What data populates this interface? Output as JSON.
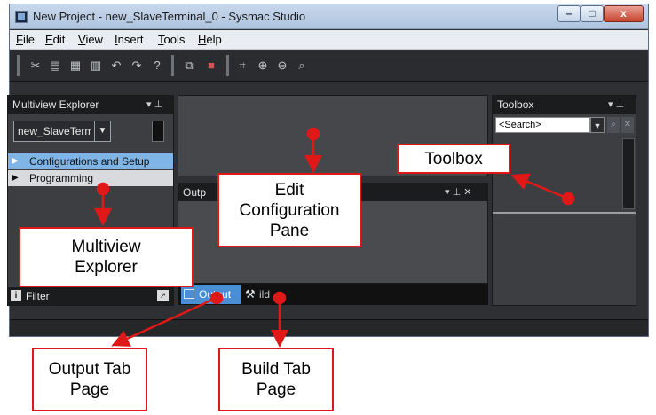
{
  "window": {
    "title": "New Project - new_SlaveTerminal_0 - Sysmac Studio",
    "controls": {
      "minimize": "–",
      "maximize": "□",
      "close": "x"
    }
  },
  "menu": {
    "items": [
      {
        "first": "F",
        "rest": "ile"
      },
      {
        "first": "E",
        "rest": "dit"
      },
      {
        "first": "V",
        "rest": "iew"
      },
      {
        "first": "I",
        "rest": "nsert"
      },
      {
        "first": "T",
        "rest": "ools"
      },
      {
        "first": "H",
        "rest": "elp"
      }
    ]
  },
  "toolbar": {
    "icons": [
      "cut-icon",
      "copy-icon",
      "paste-icon",
      "delete-icon",
      "undo-icon",
      "redo-icon",
      "help-icon",
      "window-icon",
      "error-icon",
      "fit-icon",
      "zoom-in-icon",
      "zoom-out-icon",
      "zoom-100-icon"
    ]
  },
  "multiview": {
    "title": "Multiview Explorer",
    "pin": "▾ ⊥",
    "device_combo": "new_SlaveTerm",
    "tree": [
      {
        "arrow": "▶",
        "label": "Configurations and Setup",
        "selected": true
      },
      {
        "arrow": "▶",
        "label": "Programming",
        "selected": false
      }
    ],
    "filter_icon": "i",
    "filter_label": "Filter",
    "filter_button": "↗"
  },
  "output": {
    "title": "Outp",
    "controls": "▾ ⊥ ✕"
  },
  "tabs": {
    "output": "Output",
    "build": "ild"
  },
  "toolbox": {
    "title": "Toolbox",
    "pin": "▾ ⊥",
    "search_placeholder": "<Search>",
    "search_arrow": "▼",
    "find": "⌕",
    "clear": "✕"
  },
  "annotations": {
    "toolbox": "Toolbox",
    "edit_lines": [
      "Edit",
      "Configuration",
      "Pane"
    ],
    "multiview_lines": [
      "Multiview",
      "Explorer"
    ],
    "output_lines": [
      "Output Tab",
      "Page"
    ],
    "build_lines": [
      "Build Tab",
      "Page"
    ]
  },
  "colors": {
    "annotation_red": "#e01818",
    "selection_blue": "#7eb4e6",
    "tab_blue": "#4a8fd6",
    "window_dark": "#2e3033"
  }
}
